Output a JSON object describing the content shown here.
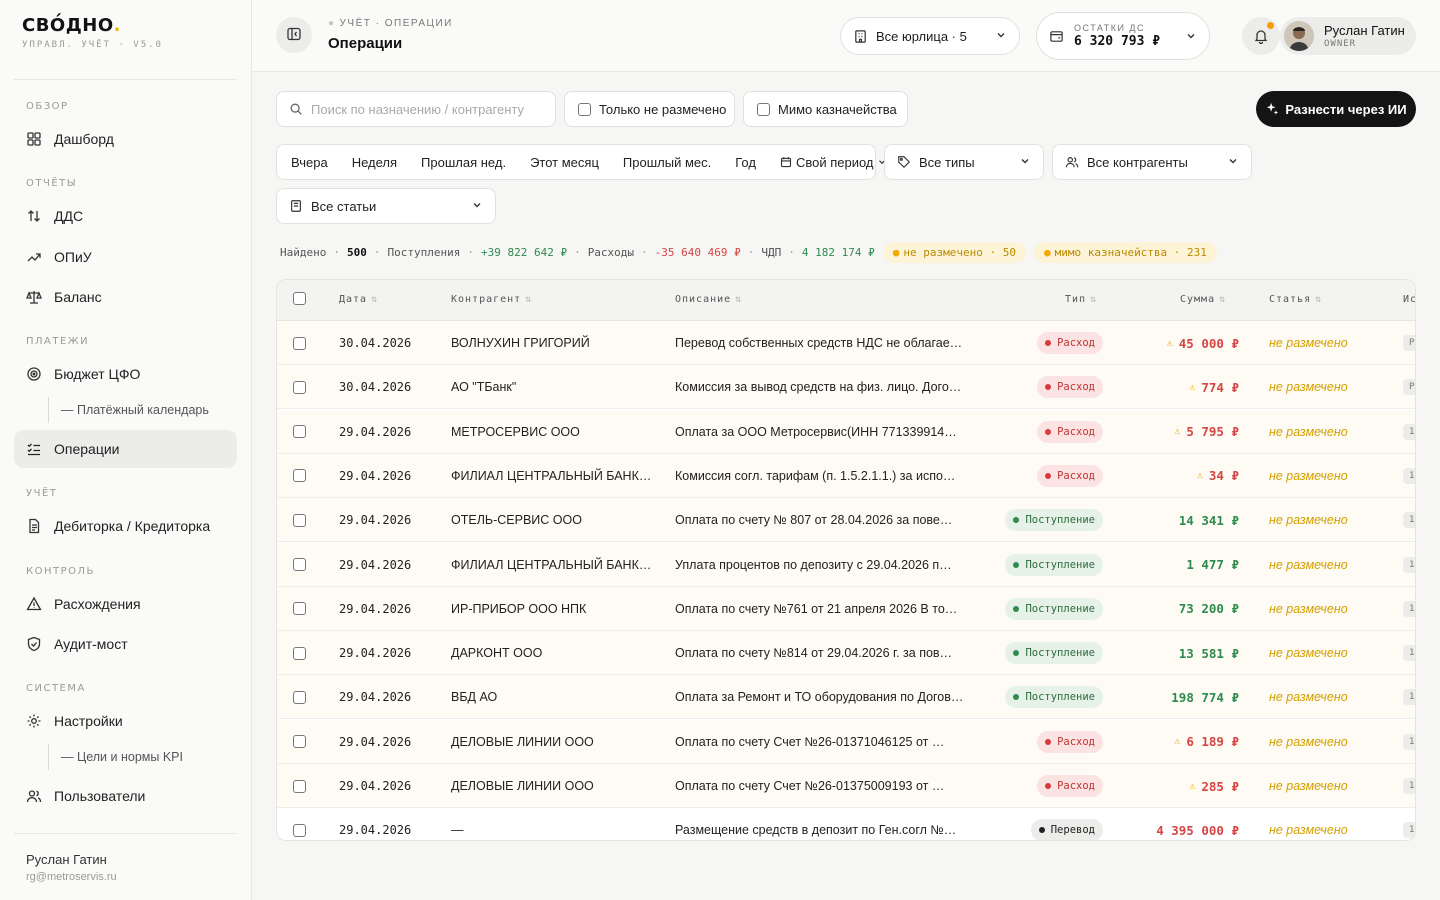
{
  "brand": {
    "name": "СВО́ДНО",
    "dot": ".",
    "subtitle": "УПРАВЛ. УЧЁТ · V5.0"
  },
  "sidebar": {
    "sections": {
      "overview": "ОБЗОР",
      "reports": "ОТЧЁТЫ",
      "payments": "ПЛАТЕЖИ",
      "accounting": "УЧЁТ",
      "control": "КОНТРОЛЬ",
      "system": "СИСТЕМА"
    },
    "items": {
      "dashboard": "Дашборд",
      "dds": "ДДС",
      "opiu": "ОПиУ",
      "balance": "Баланс",
      "budget": "Бюджет ЦФО",
      "calendar": "— Платёжный календарь",
      "operations": "Операции",
      "debtors": "Дебиторка / Кредиторка",
      "discrepancies": "Расхождения",
      "audit": "Аудит-мост",
      "settings": "Настройки",
      "kpi": "— Цели и нормы KPI",
      "users": "Пользователи"
    },
    "footer": {
      "name": "Руслан Гатин",
      "email": "rg@metroservis.ru"
    }
  },
  "header": {
    "breadcrumb": "УЧЁТ · ОПЕРАЦИИ",
    "title": "Операции",
    "legal_entities": "Все юрлица · 5",
    "balance_label": "ОСТАТКИ ДС",
    "balance_value": "6 320 793 ₽",
    "user_name": "Руслан Гатин",
    "user_role": "OWNER"
  },
  "filters": {
    "search_placeholder": "Поиск по назначению / контрагенту",
    "only_unassigned": "Только не размечено",
    "bypass_treasury": "Мимо казначейства",
    "ai_button": "Разнести через ИИ",
    "periods": [
      "Вчера",
      "Неделя",
      "Прошлая нед.",
      "Этот месяц",
      "Прошлый мес.",
      "Год"
    ],
    "custom_period": "Свой период",
    "types": "Все типы",
    "counterparties": "Все контрагенты",
    "articles": "Все статьи"
  },
  "summary": {
    "found_label": "Найдено",
    "found_value": "500",
    "income_label": "Поступления",
    "income_value": "+39 822 642 ₽",
    "expense_label": "Расходы",
    "expense_value": "-35 640 469 ₽",
    "cdp_label": "ЧДП",
    "cdp_value": "4 182 174 ₽",
    "unassigned_chip": "не размечено · 50",
    "treasury_chip": "мимо казначейства · 231"
  },
  "table": {
    "headers": {
      "date": "Дата",
      "counterparty": "Контрагент",
      "description": "Описание",
      "type": "Тип",
      "amount": "Сумма",
      "article": "Статья",
      "source": "Ис"
    },
    "rows": [
      {
        "date": "30.04.2026",
        "counterparty": "ВОЛНУХИН ГРИГОРИЙ",
        "description": "Перевод собственных средств НДС не облагае…",
        "type": "Расход",
        "kind": "exp",
        "amount": "45 000 ₽",
        "warn": true,
        "article": "не размечено",
        "src": "Р"
      },
      {
        "date": "30.04.2026",
        "counterparty": "АО \"ТБанк\"",
        "description": "Комиссия за вывод средств на физ. лицо. Дого…",
        "type": "Расход",
        "kind": "exp",
        "amount": "774 ₽",
        "warn": true,
        "article": "не размечено",
        "src": "Р"
      },
      {
        "date": "29.04.2026",
        "counterparty": "МЕТРОСЕРВИС ООО",
        "description": "Оплата за ООО Метросервис(ИНН 771339914…",
        "type": "Расход",
        "kind": "exp",
        "amount": "5 795 ₽",
        "warn": true,
        "article": "не размечено",
        "src": "1"
      },
      {
        "date": "29.04.2026",
        "counterparty": "ФИЛИАЛ ЦЕНТРАЛЬНЫЙ БАНК…",
        "description": "Комиссия согл. тарифам (п. 1.5.2.1.1.) за испо…",
        "type": "Расход",
        "kind": "exp",
        "amount": "34 ₽",
        "warn": true,
        "article": "не размечено",
        "src": "1"
      },
      {
        "date": "29.04.2026",
        "counterparty": "ОТЕЛЬ-СЕРВИС ООО",
        "description": "Оплата по счету № 807 от 28.04.2026 за пове…",
        "type": "Поступление",
        "kind": "inc",
        "amount": "14 341 ₽",
        "warn": false,
        "article": "не размечено",
        "src": "1"
      },
      {
        "date": "29.04.2026",
        "counterparty": "ФИЛИАЛ ЦЕНТРАЛЬНЫЙ БАНК…",
        "description": "Уплата процентов по депозиту с 29.04.2026 п…",
        "type": "Поступление",
        "kind": "inc",
        "amount": "1 477 ₽",
        "warn": false,
        "article": "не размечено",
        "src": "1"
      },
      {
        "date": "29.04.2026",
        "counterparty": "ИР-ПРИБОР ООО НПК",
        "description": "Оплата по счету №761 от 21 апреля 2026 В то…",
        "type": "Поступление",
        "kind": "inc",
        "amount": "73 200 ₽",
        "warn": false,
        "article": "не размечено",
        "src": "1"
      },
      {
        "date": "29.04.2026",
        "counterparty": "ДАРКОНТ ООО",
        "description": "Оплата по счету №814 от 29.04.2026 г. за пов…",
        "type": "Поступление",
        "kind": "inc",
        "amount": "13 581 ₽",
        "warn": false,
        "article": "не размечено",
        "src": "1"
      },
      {
        "date": "29.04.2026",
        "counterparty": "ВБД АО",
        "description": "Оплата за Ремонт и ТО оборудования по Догов…",
        "type": "Поступление",
        "kind": "inc",
        "amount": "198 774 ₽",
        "warn": false,
        "article": "не размечено",
        "src": "1"
      },
      {
        "date": "29.04.2026",
        "counterparty": "ДЕЛОВЫЕ ЛИНИИ ООО",
        "description": "Оплата по счету Счет №26-01371046125 от …",
        "type": "Расход",
        "kind": "exp",
        "amount": "6 189 ₽",
        "warn": true,
        "article": "не размечено",
        "src": "1"
      },
      {
        "date": "29.04.2026",
        "counterparty": "ДЕЛОВЫЕ ЛИНИИ ООО",
        "description": "Оплата по счету Счет №26-01375009193 от …",
        "type": "Расход",
        "kind": "exp",
        "amount": "285 ₽",
        "warn": true,
        "article": "не размечено",
        "src": "1"
      },
      {
        "date": "29.04.2026",
        "counterparty": "—",
        "description": "Размещение средств в депозит по Ген.согл №…",
        "type": "Перевод",
        "kind": "tr",
        "amount": "4 395 000 ₽",
        "warn": false,
        "article": "не размечено",
        "src": "1"
      }
    ]
  }
}
